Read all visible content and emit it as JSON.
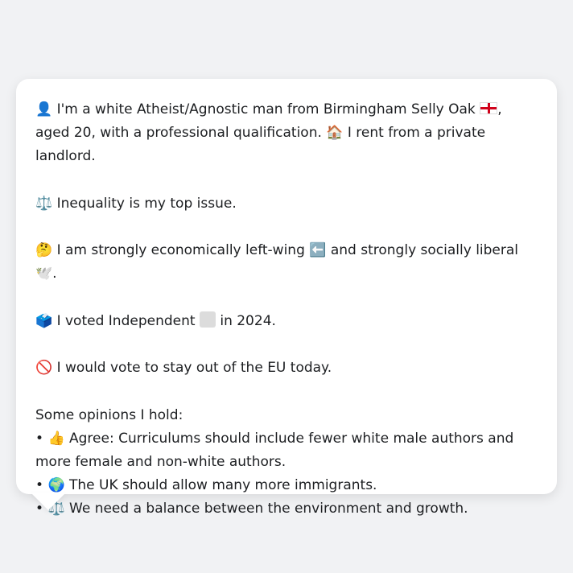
{
  "profile": {
    "intro": {
      "icon": "👤",
      "text_1": "I'm a white Atheist/Agnostic man from Birmingham Selly Oak",
      "flag": "england-flag-icon",
      "text_2": ", aged 20, with a professional qualification.",
      "house_icon": "🏠",
      "text_3": "I rent from a private landlord."
    },
    "issue": {
      "icon": "⚖️",
      "text": "Inequality is my top issue."
    },
    "politics": {
      "icon": "🤔",
      "text_1": "I am strongly economically left-wing",
      "left_icon": "⬅️",
      "text_2": "and strongly socially liberal",
      "dove_icon": "🕊️",
      "text_3": "."
    },
    "vote": {
      "icon": "🗳️",
      "text_1": "I voted Independent",
      "party_color_icon": "grey-square",
      "text_2": "in 2024."
    },
    "eu": {
      "icon": "🚫",
      "text": "I would vote to stay out of the EU today."
    },
    "opinions": {
      "heading": "Some opinions I hold:",
      "items": [
        {
          "bullet": "•",
          "icon": "👍",
          "text": "Agree: Curriculums should include fewer white male authors and more female and non-white authors."
        },
        {
          "bullet": "•",
          "icon": "🌍",
          "text": "The UK should allow many more immigrants."
        },
        {
          "bullet": "•",
          "icon": "⚖️",
          "text": "We need a balance between the environment and growth."
        }
      ]
    }
  }
}
